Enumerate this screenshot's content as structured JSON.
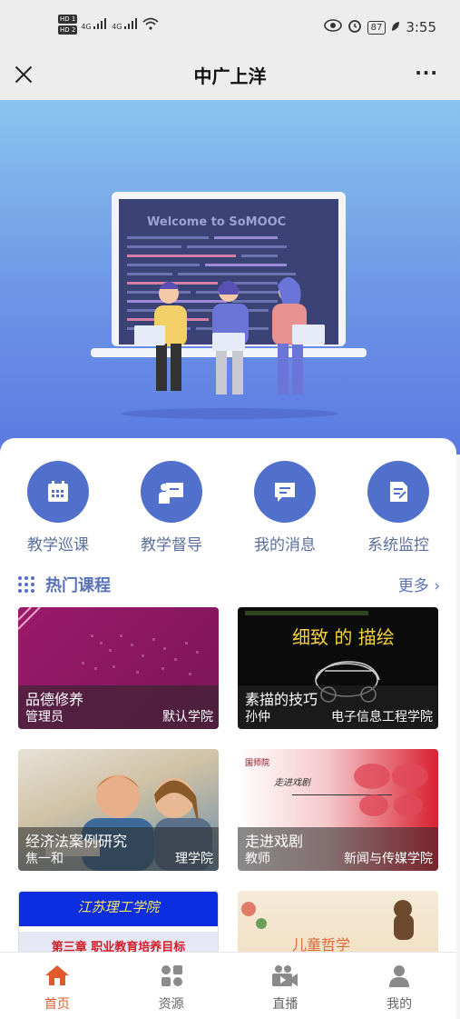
{
  "status_bar": {
    "hd1": "HD 1",
    "hd2": "HD 2",
    "net1": "4G",
    "net2": "4G",
    "battery": "87",
    "time": "3:55"
  },
  "nav": {
    "title": "中广上洋",
    "more": "···"
  },
  "banner": {
    "screen_text": "Welcome to SoMOOC"
  },
  "quick_menu": [
    {
      "label": "教学巡课",
      "icon": "calendar-icon"
    },
    {
      "label": "教学督导",
      "icon": "teacher-board-icon"
    },
    {
      "label": "我的消息",
      "icon": "message-icon"
    },
    {
      "label": "系统监控",
      "icon": "document-icon"
    }
  ],
  "section": {
    "title": "热门课程",
    "more": "更多"
  },
  "courses": [
    {
      "title": "品德修养",
      "teacher": "管理员",
      "school": "默认学院"
    },
    {
      "title": "素描的技巧",
      "teacher": "孙仲",
      "school": "电子信息工程学院",
      "cover_text": "细致 的 描绘"
    },
    {
      "title": "经济法案例研究",
      "teacher": "焦一和",
      "school": "理学院"
    },
    {
      "title": "走进戏剧",
      "teacher": "教师",
      "school": "新闻与传媒学院",
      "cover_text": "走进戏剧"
    },
    {
      "cover_text_1": "江苏理工学院",
      "cover_text_2": "第三章 职业教育培养目标"
    },
    {
      "cover_text": "儿童哲学"
    }
  ],
  "tabs": [
    {
      "label": "首页",
      "icon": "home-icon",
      "active": true
    },
    {
      "label": "资源",
      "icon": "resource-icon",
      "active": false
    },
    {
      "label": "直播",
      "icon": "live-icon",
      "active": false
    },
    {
      "label": "我的",
      "icon": "profile-icon",
      "active": false
    }
  ],
  "colors": {
    "accent": "#5170cc",
    "active_tab": "#e05a2b"
  }
}
